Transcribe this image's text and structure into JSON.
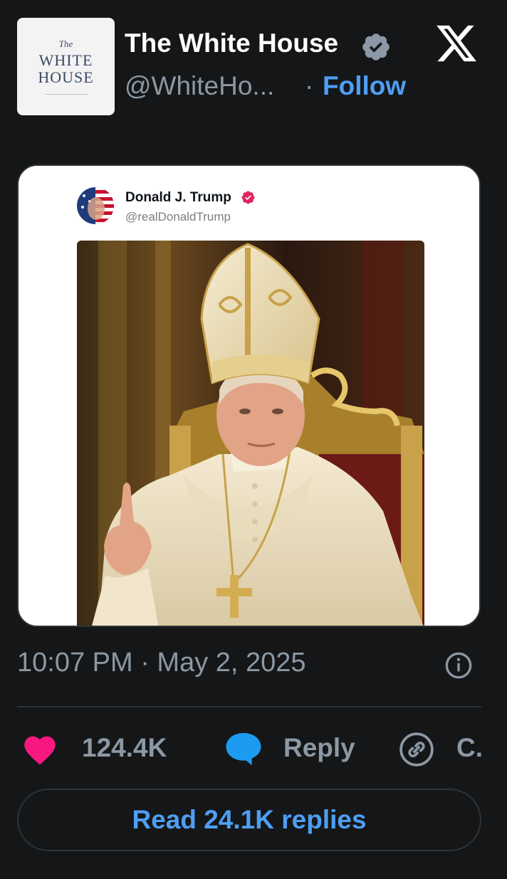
{
  "author": {
    "logo": {
      "the": "The",
      "line1": "WHITE",
      "line2": "HOUSE"
    },
    "name": "The White House",
    "handle": "@WhiteHo...",
    "separator": "·",
    "follow_label": "Follow",
    "verified_icon": "verified-badge-icon"
  },
  "platform_icon": "x-logo-icon",
  "embedded_post": {
    "name": "Donald J. Trump",
    "handle": "@realDonaldTrump",
    "verified_color": "#e0245e",
    "image": "papal-portrait-photo"
  },
  "timestamp": "10:07 PM · May 2, 2025",
  "actions": {
    "likes": "124.4K",
    "reply_label": "Reply",
    "copy_label": "C.",
    "like_color": "#f91880",
    "reply_color": "#1d9bf0"
  },
  "read_replies_label": "Read 24.1K replies",
  "colors": {
    "background": "#151617",
    "accent": "#4d9ff3"
  }
}
